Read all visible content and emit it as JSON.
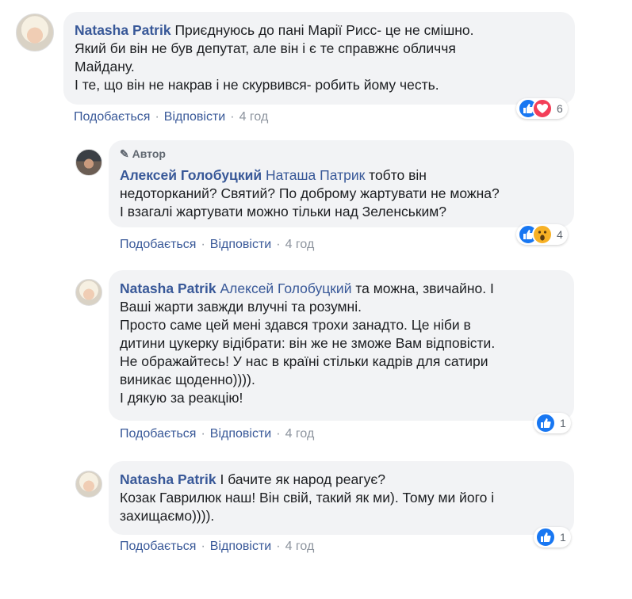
{
  "comments": [
    {
      "author": "Natasha Patrik",
      "lines": [
        "Приєднуюсь до пані Марії Рисс- це не смішно.",
        "Який би він не був депутат, але він і є те справжнє обличчя",
        "Майдану.",
        "І те, що він не накрав і не скурвився- робить йому честь."
      ],
      "like_label": "Подобається",
      "reply_label": "Відповісти",
      "time": "4 год",
      "reactions": [
        "like-icon",
        "love-icon"
      ],
      "reaction_count": "6"
    },
    {
      "badge": "Автор",
      "author": "Алексей Голобуцкий",
      "mention": "Наташа Патрик",
      "lines": [
        "тобто він",
        "недоторканий? Святий? По доброму жартувати не можна?",
        "І взагалі жартувати можно тільки над Зеленським?"
      ],
      "like_label": "Подобається",
      "reply_label": "Відповісти",
      "time": "4 год",
      "reactions": [
        "like-icon",
        "wow-icon"
      ],
      "reaction_count": "4"
    },
    {
      "author": "Natasha Patrik",
      "mention": "Алексей Голобуцкий",
      "lines": [
        "та можна, звичайно. І",
        "Ваші жарти завжди влучні та розумні.",
        "Просто саме цей мені здався трохи занадто. Це ніби в",
        "дитини цукерку відібрати: він же не зможе Вам відповісти.",
        "Не ображайтесь! У нас в країні стільки кадрів для сатири",
        "виникає щоденно)))).",
        "І дякую за реакцію!"
      ],
      "like_label": "Подобається",
      "reply_label": "Відповісти",
      "time": "4 год",
      "reactions": [
        "like-icon"
      ],
      "reaction_count": "1"
    },
    {
      "author": "Natasha Patrik",
      "lines": [
        "І бачите як народ реагує?",
        "Козак Гаврилюк наш! Він свій, такий як ми). Тому ми його і",
        "захищаємо))))."
      ],
      "like_label": "Подобається",
      "reply_label": "Відповісти",
      "time": "4 год",
      "reactions": [
        "like-icon"
      ],
      "reaction_count": "1"
    }
  ],
  "colors": {
    "link": "#385898",
    "bubble": "#f2f3f5",
    "meta": "#8d949e",
    "like": "#1877f2",
    "love": "#f33e58",
    "wow": "#f7b125"
  }
}
